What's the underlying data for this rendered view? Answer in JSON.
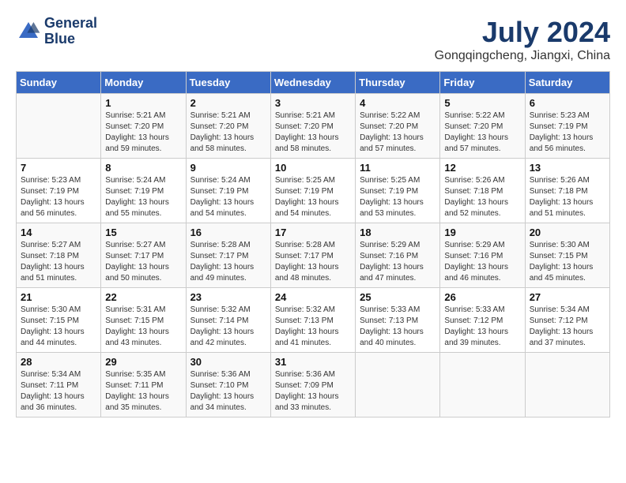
{
  "logo": {
    "line1": "General",
    "line2": "Blue"
  },
  "title": {
    "month_year": "July 2024",
    "location": "Gongqingcheng, Jiangxi, China"
  },
  "days_of_week": [
    "Sunday",
    "Monday",
    "Tuesday",
    "Wednesday",
    "Thursday",
    "Friday",
    "Saturday"
  ],
  "weeks": [
    [
      {
        "day": "",
        "info": ""
      },
      {
        "day": "1",
        "info": "Sunrise: 5:21 AM\nSunset: 7:20 PM\nDaylight: 13 hours\nand 59 minutes."
      },
      {
        "day": "2",
        "info": "Sunrise: 5:21 AM\nSunset: 7:20 PM\nDaylight: 13 hours\nand 58 minutes."
      },
      {
        "day": "3",
        "info": "Sunrise: 5:21 AM\nSunset: 7:20 PM\nDaylight: 13 hours\nand 58 minutes."
      },
      {
        "day": "4",
        "info": "Sunrise: 5:22 AM\nSunset: 7:20 PM\nDaylight: 13 hours\nand 57 minutes."
      },
      {
        "day": "5",
        "info": "Sunrise: 5:22 AM\nSunset: 7:20 PM\nDaylight: 13 hours\nand 57 minutes."
      },
      {
        "day": "6",
        "info": "Sunrise: 5:23 AM\nSunset: 7:19 PM\nDaylight: 13 hours\nand 56 minutes."
      }
    ],
    [
      {
        "day": "7",
        "info": "Sunrise: 5:23 AM\nSunset: 7:19 PM\nDaylight: 13 hours\nand 56 minutes."
      },
      {
        "day": "8",
        "info": "Sunrise: 5:24 AM\nSunset: 7:19 PM\nDaylight: 13 hours\nand 55 minutes."
      },
      {
        "day": "9",
        "info": "Sunrise: 5:24 AM\nSunset: 7:19 PM\nDaylight: 13 hours\nand 54 minutes."
      },
      {
        "day": "10",
        "info": "Sunrise: 5:25 AM\nSunset: 7:19 PM\nDaylight: 13 hours\nand 54 minutes."
      },
      {
        "day": "11",
        "info": "Sunrise: 5:25 AM\nSunset: 7:19 PM\nDaylight: 13 hours\nand 53 minutes."
      },
      {
        "day": "12",
        "info": "Sunrise: 5:26 AM\nSunset: 7:18 PM\nDaylight: 13 hours\nand 52 minutes."
      },
      {
        "day": "13",
        "info": "Sunrise: 5:26 AM\nSunset: 7:18 PM\nDaylight: 13 hours\nand 51 minutes."
      }
    ],
    [
      {
        "day": "14",
        "info": "Sunrise: 5:27 AM\nSunset: 7:18 PM\nDaylight: 13 hours\nand 51 minutes."
      },
      {
        "day": "15",
        "info": "Sunrise: 5:27 AM\nSunset: 7:17 PM\nDaylight: 13 hours\nand 50 minutes."
      },
      {
        "day": "16",
        "info": "Sunrise: 5:28 AM\nSunset: 7:17 PM\nDaylight: 13 hours\nand 49 minutes."
      },
      {
        "day": "17",
        "info": "Sunrise: 5:28 AM\nSunset: 7:17 PM\nDaylight: 13 hours\nand 48 minutes."
      },
      {
        "day": "18",
        "info": "Sunrise: 5:29 AM\nSunset: 7:16 PM\nDaylight: 13 hours\nand 47 minutes."
      },
      {
        "day": "19",
        "info": "Sunrise: 5:29 AM\nSunset: 7:16 PM\nDaylight: 13 hours\nand 46 minutes."
      },
      {
        "day": "20",
        "info": "Sunrise: 5:30 AM\nSunset: 7:15 PM\nDaylight: 13 hours\nand 45 minutes."
      }
    ],
    [
      {
        "day": "21",
        "info": "Sunrise: 5:30 AM\nSunset: 7:15 PM\nDaylight: 13 hours\nand 44 minutes."
      },
      {
        "day": "22",
        "info": "Sunrise: 5:31 AM\nSunset: 7:15 PM\nDaylight: 13 hours\nand 43 minutes."
      },
      {
        "day": "23",
        "info": "Sunrise: 5:32 AM\nSunset: 7:14 PM\nDaylight: 13 hours\nand 42 minutes."
      },
      {
        "day": "24",
        "info": "Sunrise: 5:32 AM\nSunset: 7:13 PM\nDaylight: 13 hours\nand 41 minutes."
      },
      {
        "day": "25",
        "info": "Sunrise: 5:33 AM\nSunset: 7:13 PM\nDaylight: 13 hours\nand 40 minutes."
      },
      {
        "day": "26",
        "info": "Sunrise: 5:33 AM\nSunset: 7:12 PM\nDaylight: 13 hours\nand 39 minutes."
      },
      {
        "day": "27",
        "info": "Sunrise: 5:34 AM\nSunset: 7:12 PM\nDaylight: 13 hours\nand 37 minutes."
      }
    ],
    [
      {
        "day": "28",
        "info": "Sunrise: 5:34 AM\nSunset: 7:11 PM\nDaylight: 13 hours\nand 36 minutes."
      },
      {
        "day": "29",
        "info": "Sunrise: 5:35 AM\nSunset: 7:11 PM\nDaylight: 13 hours\nand 35 minutes."
      },
      {
        "day": "30",
        "info": "Sunrise: 5:36 AM\nSunset: 7:10 PM\nDaylight: 13 hours\nand 34 minutes."
      },
      {
        "day": "31",
        "info": "Sunrise: 5:36 AM\nSunset: 7:09 PM\nDaylight: 13 hours\nand 33 minutes."
      },
      {
        "day": "",
        "info": ""
      },
      {
        "day": "",
        "info": ""
      },
      {
        "day": "",
        "info": ""
      }
    ]
  ]
}
